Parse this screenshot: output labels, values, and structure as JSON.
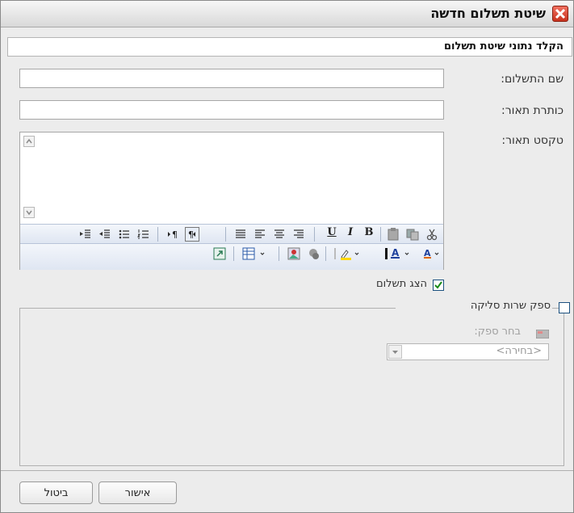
{
  "dialog": {
    "title": "שיטת תשלום חדשה",
    "section_header": "הקלד נתוני שיטת תשלום"
  },
  "fields": {
    "payment_name_label": "שם התשלום:",
    "payment_name_value": "",
    "description_title_label": "כותרת תאור:",
    "description_title_value": "",
    "description_text_label": "טקסט תאור:"
  },
  "editor": {
    "toolbar_row1": [
      "cut-icon",
      "copy-icon",
      "paste-icon",
      "bold",
      "italic",
      "underline",
      "align-right-icon",
      "align-center-icon",
      "align-left-icon",
      "justify-icon",
      "rtl-paragraph-icon",
      "ltr-paragraph-icon",
      "numbered-list-icon",
      "bulleted-list-icon",
      "outdent-icon",
      "indent-icon"
    ],
    "toolbar_row2": [
      "font-color-icon",
      "highlight-color-icon",
      "text-color-icon",
      "symbol-icon",
      "image-icon",
      "table-icon",
      "link-icon"
    ],
    "bold_label": "B",
    "italic_label": "I",
    "underline_label": "U"
  },
  "options": {
    "show_payment_label": "הצג תשלום",
    "show_payment_checked": true,
    "clearing_service_label": "ספק שרות סליקה",
    "clearing_service_checked": false,
    "choose_provider_label": "בחר ספק:",
    "provider_select_value": "<בחירה>"
  },
  "buttons": {
    "ok": "אישור",
    "cancel": "ביטול"
  },
  "colors": {
    "checkbox_check": "#1a8a1a",
    "close_button": "#d8442e"
  }
}
